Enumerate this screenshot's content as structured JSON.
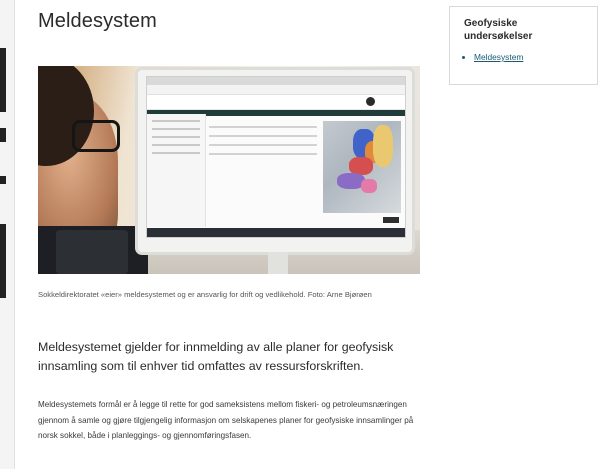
{
  "article": {
    "title": "Meldesystem",
    "image_caption": "Sokkeldirektoratet «eier» meldesystemet og er ansvarlig for drift og vedlikehold. Foto: Arne Bjørøen",
    "lead": "Meldesystemet gjelder for innmelding av alle planer for geofysisk innsamling som til enhver tid omfattes av ressursforskriften.",
    "body": "Meldesystemets formål er å legge til rette for god sameksistens mellom fiskeri- og petroleumsnæringen gjennom å samle og gjøre tilgjengelig informasjon om selskapenes planer for geofysiske innsamlinger på norsk sokkel, både i planleggings- og gjennomføringsfasen."
  },
  "sidebar": {
    "title": "Geofysiske undersøkelser",
    "links": [
      {
        "label": "Meldesystem"
      }
    ]
  },
  "colors": {
    "link": "#1a5a74",
    "text": "#2b2b2b",
    "border": "#d9d9d9"
  }
}
